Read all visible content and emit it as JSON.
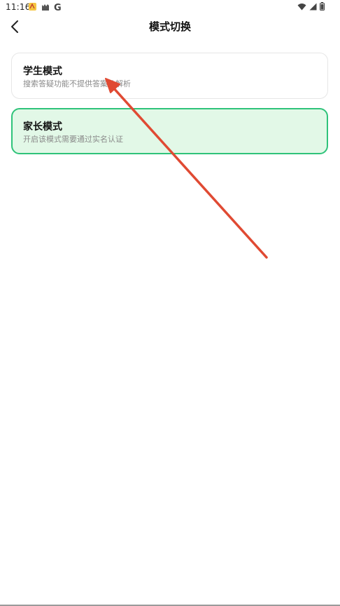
{
  "status_bar": {
    "time": "11:16",
    "left_icons": [
      "notification-emoji-icon",
      "cat-icon",
      "google-g-icon"
    ],
    "google_letter": "G",
    "right_icons": [
      "wifi-icon",
      "signal-icon",
      "battery-icon"
    ]
  },
  "header": {
    "title": "模式切换"
  },
  "modes": [
    {
      "title": "学生模式",
      "description": "搜索答疑功能不提供答案及解析",
      "selected": false
    },
    {
      "title": "家长模式",
      "description": "开启该模式需要通过实名认证",
      "selected": true
    }
  ],
  "colors": {
    "selected_border": "#2fc37a",
    "selected_background": "#e2f8e7",
    "annotation_arrow": "#e04a33"
  }
}
